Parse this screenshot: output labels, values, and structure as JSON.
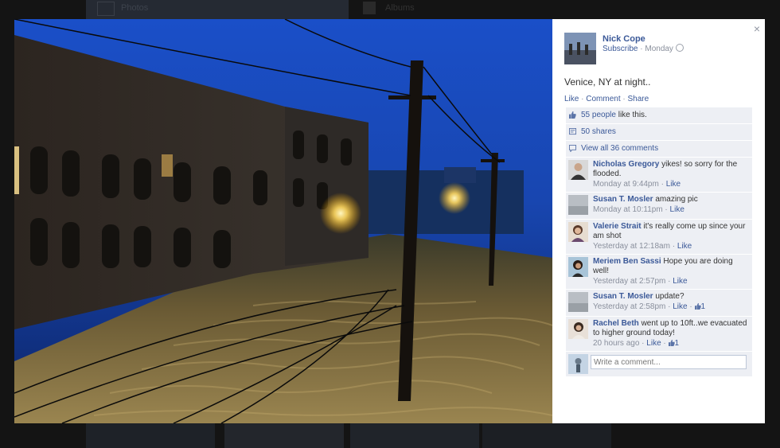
{
  "background": {
    "left_tab_label": "Photos",
    "right_tab_label": "Albums"
  },
  "lightbox": {
    "photo_description_icon": "flooded-street-photo",
    "close_label": "×",
    "owner": {
      "name": "Nick Cope",
      "subscribe_label": "Subscribe",
      "separator": " · ",
      "time": "Monday",
      "privacy_icon": "globe-icon"
    },
    "caption": "Venice, NY at night..",
    "actions": {
      "like": "Like",
      "comment": "Comment",
      "share": "Share",
      "separator": " · "
    },
    "likes": {
      "link": "55 people",
      "text": " like this."
    },
    "shares": {
      "link": "50 shares"
    },
    "view_comments": {
      "link": "View all 36 comments"
    },
    "comments": [
      {
        "author": "Nicholas Gregory",
        "text": "yikes! so sorry for the flooded.",
        "time": "Monday at 9:44pm",
        "like": "Like",
        "likes_count": ""
      },
      {
        "author": "Susan T. Mosler",
        "text": "amazing pic",
        "time": "Monday at 10:11pm",
        "like": "Like",
        "likes_count": ""
      },
      {
        "author": "Valerie Strait",
        "text": "it's really come up since your am shot",
        "time": "Yesterday at 12:18am",
        "like": "Like",
        "likes_count": ""
      },
      {
        "author": "Meriem Ben Sassi",
        "text": "Hope you are doing well!",
        "time": "Yesterday at 2:57pm",
        "like": "Like",
        "likes_count": ""
      },
      {
        "author": "Susan T. Mosler",
        "text": "update?",
        "time": "Yesterday at 2:58pm",
        "like": "Like",
        "likes_count": "1"
      },
      {
        "author": "Rachel Beth",
        "text": "went up to 10ft..we evacuated to higher ground today!",
        "time": "20 hours ago",
        "like": "Like",
        "likes_count": "1"
      }
    ],
    "write_comment": {
      "placeholder": "Write a comment..."
    },
    "colors": {
      "link": "#3b5998",
      "ufi_bg": "#edeff4",
      "meta": "#898f9c"
    }
  }
}
